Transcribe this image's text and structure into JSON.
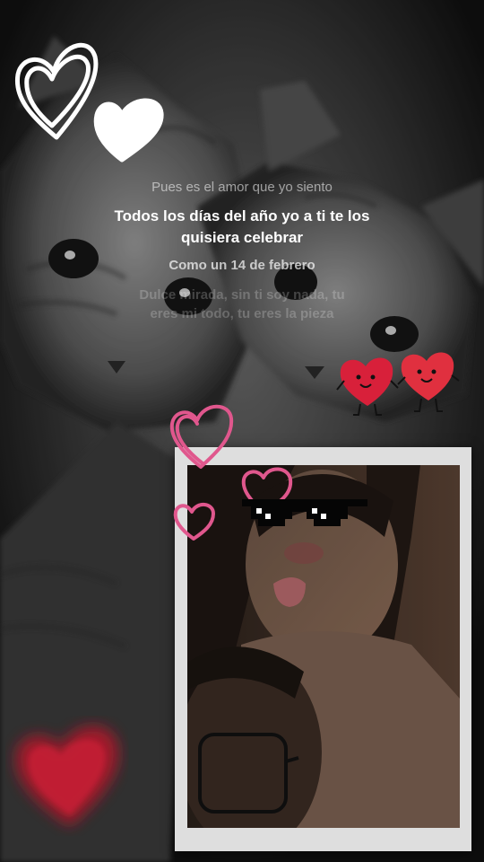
{
  "lyrics": {
    "previous": "Pues es el amor que yo siento",
    "current": "Todos los días del año yo a ti te los quisiera celebrar",
    "next": "Como un 14 de febrero",
    "upcoming": "Dulce mirada, sin ti soy nada, tu eres mi todo, tu eres la pieza"
  },
  "stickers": {
    "white_hearts": "white-scribble-hearts",
    "red_hearts": "red-fingerprint-heart-characters",
    "pink_hearts": "pink-outline-hearts",
    "sunglasses": "pixel-sunglasses",
    "blurred_heart": "blurred-red-heart"
  },
  "colors": {
    "background": "#141414",
    "lyric_current": "#ffffff",
    "polaroid_frame": "#dedede",
    "pink_heart": "#e0578d",
    "red_heart": "#d8203a"
  }
}
